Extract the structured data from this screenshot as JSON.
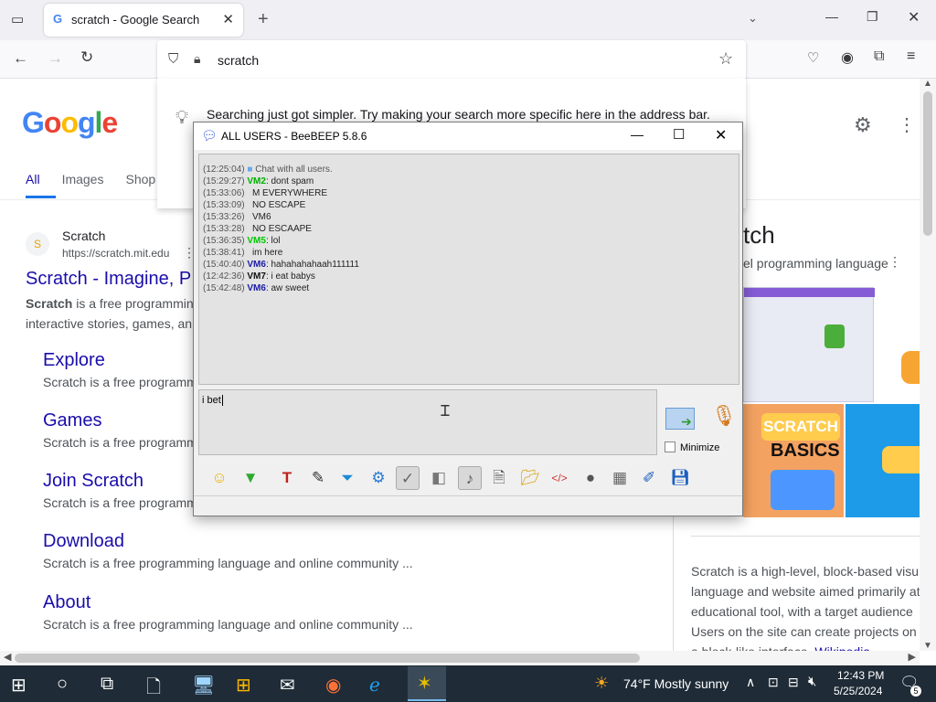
{
  "browser": {
    "tab_title": "scratch - Google Search",
    "url": "scratch",
    "suggestion": "Searching just got simpler. Try making your search more specific here in the address bar."
  },
  "google": {
    "logo": "Google",
    "tabs": [
      "All",
      "Images",
      "Shop"
    ],
    "result": {
      "site": "Scratch",
      "url": "https://scratch.mit.edu",
      "title": "Scratch - Imagine, P",
      "snippet1_bold": "Scratch",
      "snippet1": " is a free programmin",
      "snippet2": "interactive stories, games, an"
    },
    "sublinks": [
      {
        "title": "Explore",
        "snippet": "Scratch is a free programm"
      },
      {
        "title": "Games",
        "snippet": "Scratch is a free programm"
      },
      {
        "title": "Join Scratch",
        "snippet": "Scratch is a free programm"
      },
      {
        "title": "Download",
        "snippet": "Scratch is a free programming language and online community ..."
      },
      {
        "title": "About",
        "snippet": "Scratch is a free programming language and online community ..."
      }
    ],
    "knowledge": {
      "title": "tch",
      "subtitle": "el programming language",
      "basics_label": "BASICS",
      "scratch_logo": "SCRATCH",
      "desc1": "Scratch is a high-level, block-based visu",
      "desc2": "language and website aimed primarily at",
      "desc3": "educational tool, with a target audience",
      "desc4": "Users on the site can create projects on",
      "desc5": "a block-like interface.",
      "wiki": "Wikipedia"
    }
  },
  "beebeep": {
    "title": "ALL USERS - BeeBEEP 5.8.6",
    "messages": [
      {
        "time": "(12:25:04)",
        "user": "",
        "text": "Chat with all users.",
        "color": "#555555"
      },
      {
        "time": "(15:29:27)",
        "user": "VM2",
        "text": ": dont spam",
        "color": "#00b000"
      },
      {
        "time": "(15:33:06)",
        "user": "",
        "text": "M EVERYWHERE",
        "color": "#222222"
      },
      {
        "time": "(15:33:09)",
        "user": "",
        "text": "NO ESCAPE",
        "color": "#222222"
      },
      {
        "time": "(15:33:26)",
        "user": "",
        "text": "VM6",
        "color": "#222222"
      },
      {
        "time": "(15:33:28)",
        "user": "",
        "text": "NO ESCAAPE",
        "color": "#222222"
      },
      {
        "time": "(15:36:35)",
        "user": "VM5",
        "text": ": lol",
        "color": "#00c800"
      },
      {
        "time": "(15:38:41)",
        "user": "",
        "text": "im here",
        "color": "#222222"
      },
      {
        "time": "(15:40:40)",
        "user": "VM6",
        "text": ": hahahahahaah111111",
        "color": "#1a1aa6"
      },
      {
        "time": "(12:42:36)",
        "user": "VM7",
        "text": ": i eat babys",
        "color": "#111111"
      },
      {
        "time": "(15:42:48)",
        "user": "VM6",
        "text": ": aw sweet",
        "color": "#1a1aa6"
      }
    ],
    "input_text": "i bet",
    "minimize_label": "Minimize"
  },
  "taskbar": {
    "weather": "74°F  Mostly sunny",
    "time": "12:43 PM",
    "date": "5/25/2024",
    "notif_count": "5"
  }
}
